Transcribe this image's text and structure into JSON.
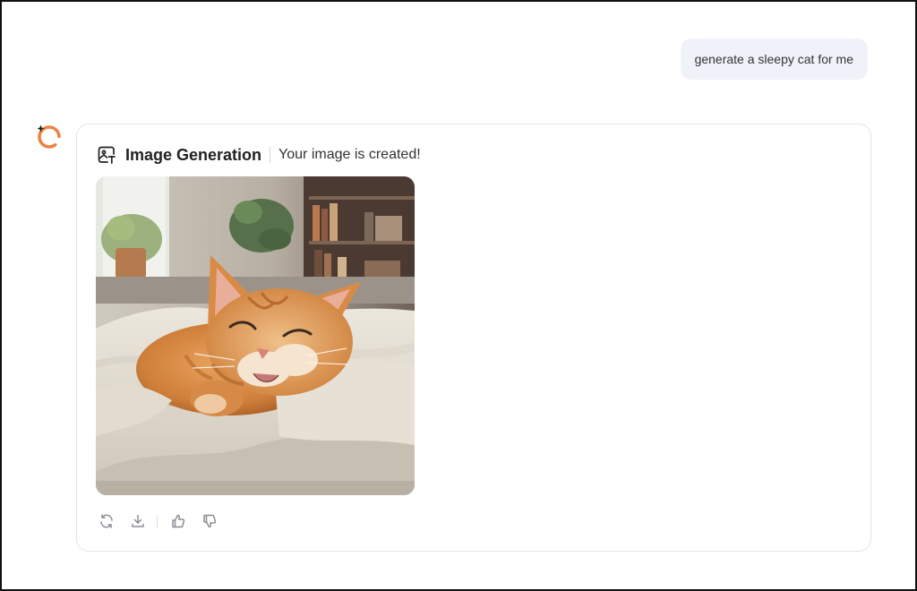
{
  "conversation": {
    "user_message": "generate a sleepy cat for me",
    "assistant": {
      "avatar_icon": "assistant-logo-icon",
      "tool": {
        "icon": "image-generation-icon",
        "title": "Image Generation",
        "status": "Your image is created!"
      },
      "image": {
        "subject": "sleepy-cat-image"
      },
      "actions": [
        {
          "name": "regenerate",
          "icon": "refresh-icon"
        },
        {
          "name": "download",
          "icon": "download-icon"
        },
        {
          "name": "like",
          "icon": "thumbs-up-icon"
        },
        {
          "name": "dislike",
          "icon": "thumbs-down-icon"
        }
      ]
    }
  },
  "colors": {
    "accent": "#f0813f",
    "user_bubble_bg": "#eff2f8",
    "card_border": "#e3e5ea",
    "icon_gray": "#8a8d94"
  }
}
